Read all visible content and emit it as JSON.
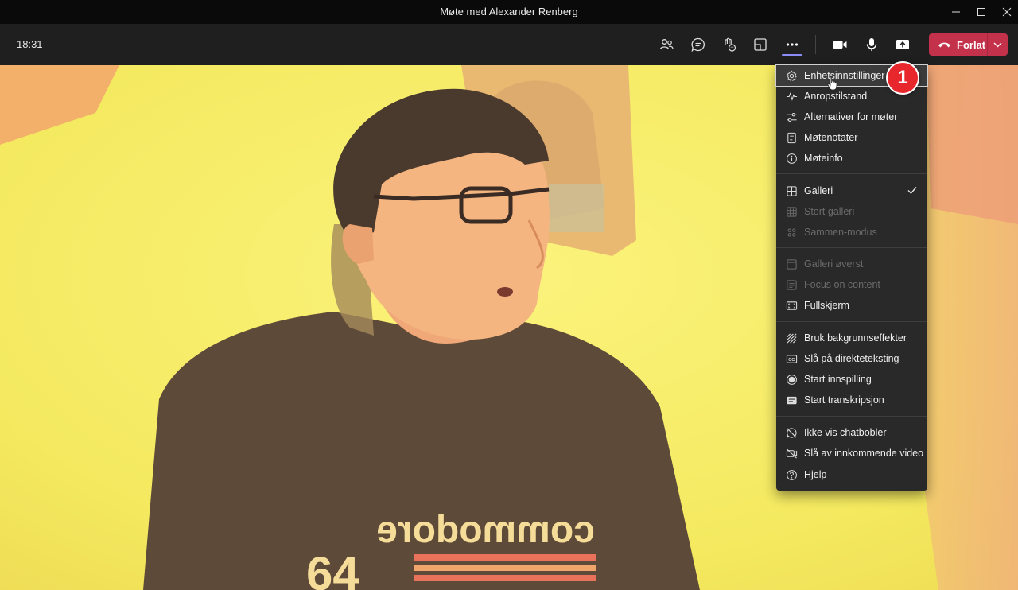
{
  "window": {
    "title": "Møte med Alexander Renberg"
  },
  "toolbar": {
    "time": "18:31",
    "buttons": [
      "people-icon",
      "chat-icon",
      "reactions-icon",
      "rooms-icon",
      "more-icon",
      "camera-icon",
      "mic-icon",
      "share-icon"
    ],
    "leave_label": "Forlat",
    "leave_color": "#c4314b"
  },
  "video": {
    "shirt_text": "commodore",
    "shirt_number": "64"
  },
  "menu": {
    "items": [
      {
        "label": "Enhetsinnstillinger",
        "icon": "gear-icon",
        "enabled": true,
        "highlighted": true
      },
      {
        "label": "Anropstilstand",
        "icon": "pulse-icon",
        "enabled": true
      },
      {
        "label": "Alternativer for møter",
        "icon": "sliders-icon",
        "enabled": true
      },
      {
        "label": "Møtenotater",
        "icon": "notes-icon",
        "enabled": true
      },
      {
        "label": "Møteinfo",
        "icon": "info-icon",
        "enabled": true
      },
      {
        "label": "Galleri",
        "icon": "gallery-icon",
        "enabled": true,
        "checked": true
      },
      {
        "label": "Stort galleri",
        "icon": "large-gallery-icon",
        "enabled": false
      },
      {
        "label": "Sammen-modus",
        "icon": "together-icon",
        "enabled": false
      },
      {
        "label": "Galleri øverst",
        "icon": "gallery-top-icon",
        "enabled": false
      },
      {
        "label": "Focus on content",
        "icon": "focus-icon",
        "enabled": false
      },
      {
        "label": "Fullskjerm",
        "icon": "fullscreen-icon",
        "enabled": true
      },
      {
        "label": "Bruk bakgrunnseffekter",
        "icon": "background-effects-icon",
        "enabled": true
      },
      {
        "label": "Slå på direkteteksting",
        "icon": "captions-icon",
        "enabled": true
      },
      {
        "label": "Start innspilling",
        "icon": "record-icon",
        "enabled": true
      },
      {
        "label": "Start transkripsjon",
        "icon": "transcript-icon",
        "enabled": true
      },
      {
        "label": "Ikke vis chatbobler",
        "icon": "no-chat-bubbles-icon",
        "enabled": true
      },
      {
        "label": "Slå av innkommende video",
        "icon": "video-off-icon",
        "enabled": true
      },
      {
        "label": "Hjelp",
        "icon": "help-icon",
        "enabled": true
      }
    ]
  },
  "annotation": {
    "number": "1",
    "color": "#e8272d"
  }
}
